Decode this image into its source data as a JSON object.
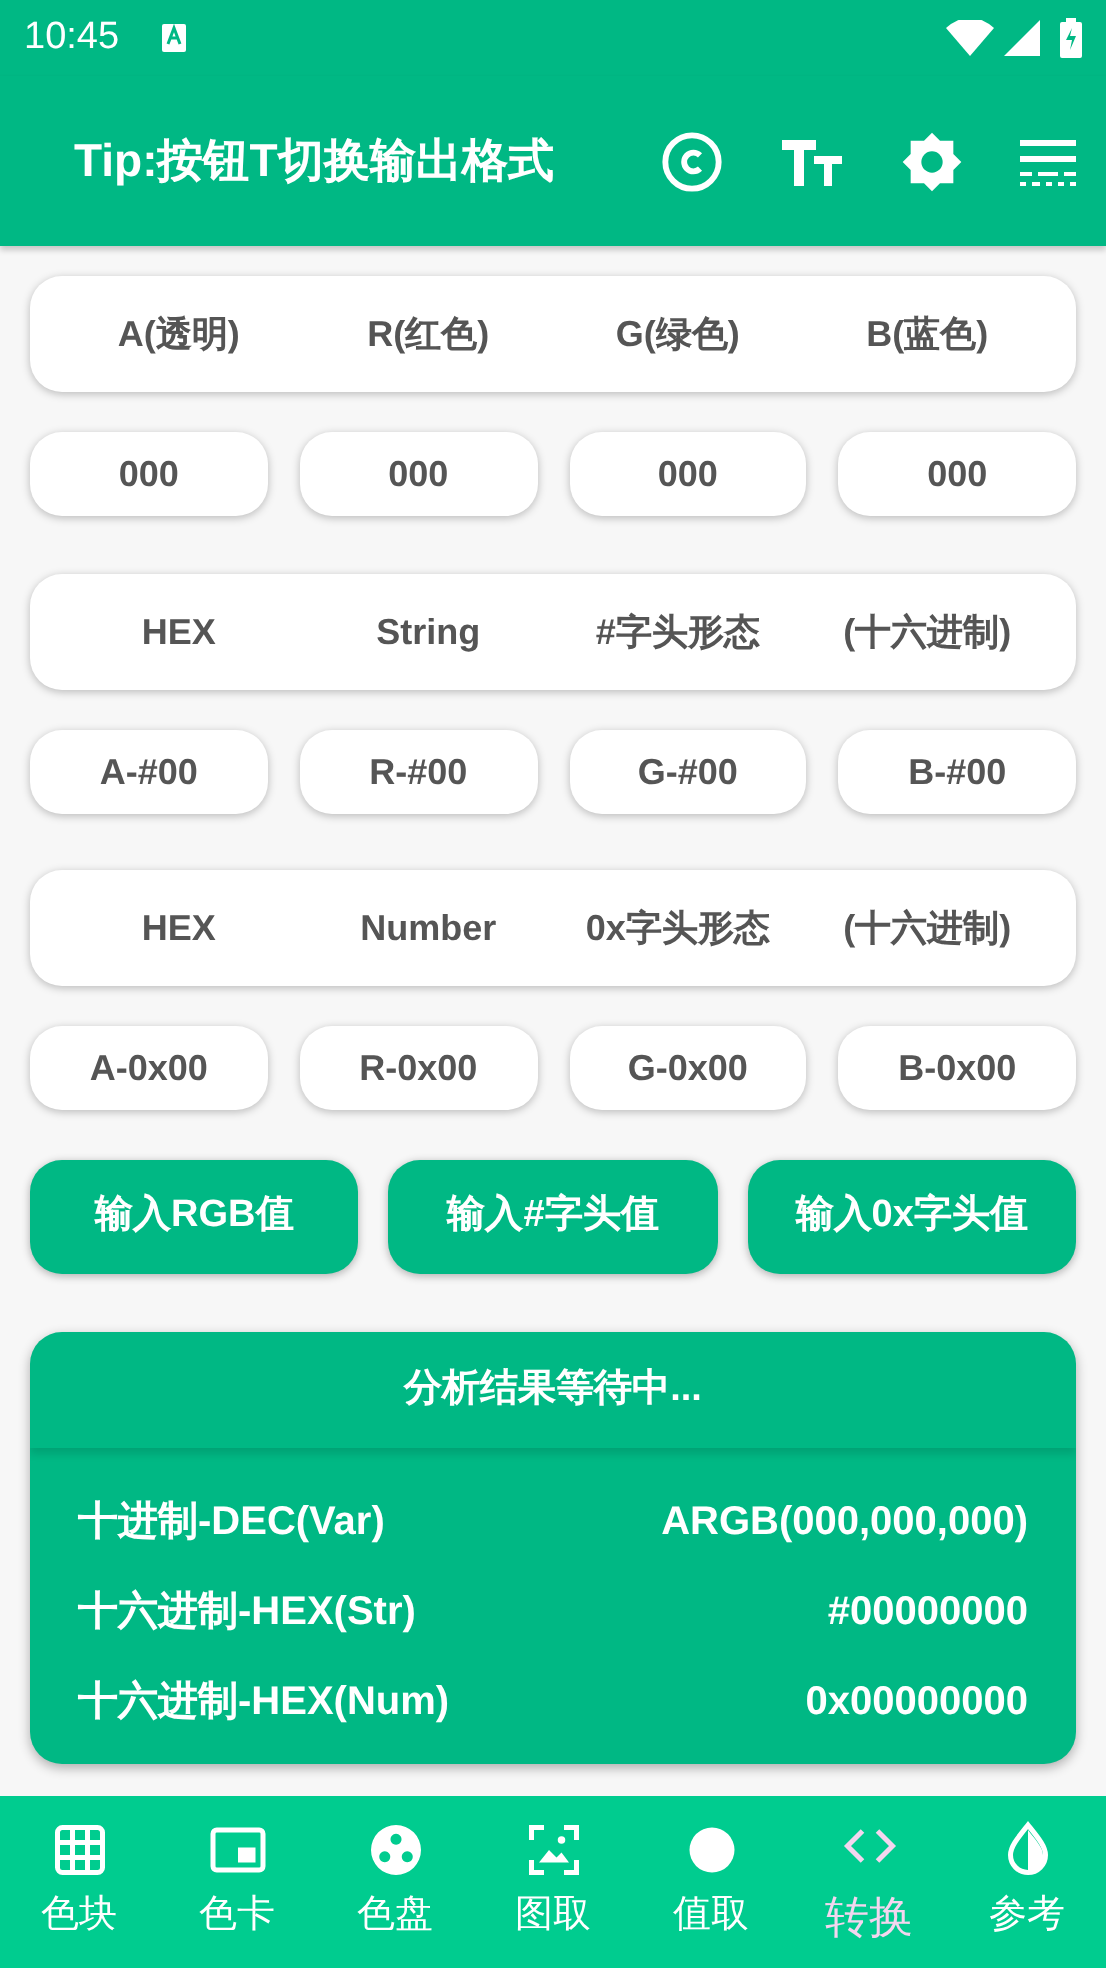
{
  "status_bar": {
    "time": "10:45"
  },
  "app_bar": {
    "title": "Tip:按钮T切换输出格式"
  },
  "channel_header": [
    "A(透明)",
    "R(红色)",
    "G(绿色)",
    "B(蓝色)"
  ],
  "channel_values": [
    "000",
    "000",
    "000",
    "000"
  ],
  "hash_header": [
    "HEX",
    "String",
    "#字头形态",
    "(十六进制)"
  ],
  "hash_values": [
    "A-#00",
    "R-#00",
    "G-#00",
    "B-#00"
  ],
  "hex_header": [
    "HEX",
    "Number",
    "0x字头形态",
    "(十六进制)"
  ],
  "hex_values": [
    "A-0x00",
    "R-0x00",
    "G-0x00",
    "B-0x00"
  ],
  "buttons": [
    "输入RGB值",
    "输入#字头值",
    "输入0x字头值"
  ],
  "result": {
    "title": "分析结果等待中...",
    "rows": [
      {
        "label": "十进制-DEC(Var)",
        "value": "ARGB(000,000,000)"
      },
      {
        "label": "十六进制-HEX(Str)",
        "value": "#00000000"
      },
      {
        "label": "十六进制-HEX(Num)",
        "value": "0x00000000"
      }
    ]
  },
  "bottom_nav": [
    {
      "label": "色块",
      "kind": "grid",
      "selected": false
    },
    {
      "label": "色卡",
      "kind": "card",
      "selected": false
    },
    {
      "label": "色盘",
      "kind": "palette",
      "selected": false
    },
    {
      "label": "图取",
      "kind": "image",
      "selected": false
    },
    {
      "label": "值取",
      "kind": "dot",
      "selected": false
    },
    {
      "label": "转换",
      "kind": "code",
      "selected": true
    },
    {
      "label": "参考",
      "kind": "drop",
      "selected": false
    }
  ]
}
